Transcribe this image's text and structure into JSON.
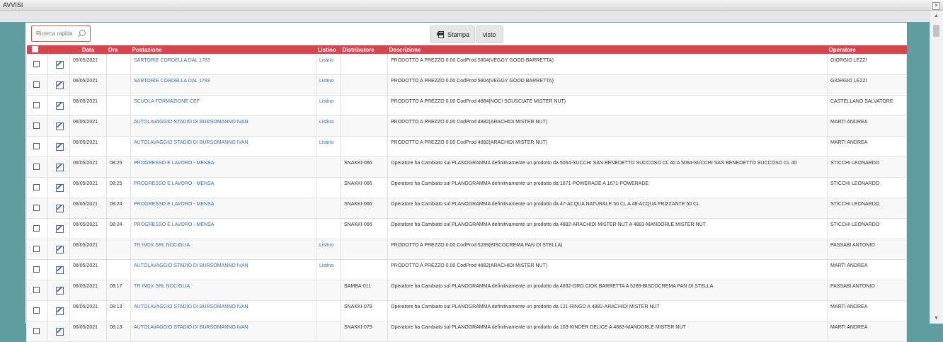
{
  "window": {
    "title": "AVVISI",
    "close_glyph": "×"
  },
  "toolbar": {
    "search_placeholder": "Ricerca rapida",
    "print_label": "Stampa",
    "seen_label": "visto"
  },
  "table": {
    "columns": [
      "Data",
      "Ora",
      "Postazione",
      "Listino",
      "Distributore",
      "Descrizione",
      "Operatore"
    ],
    "rows": [
      [
        "06/05/2021",
        "",
        "SARTORIE CORDELLA DAL 1783",
        "Listino",
        "",
        "PRODOTTO A PREZZO 0.00 CodProd 5804(VEGGY GOOD BARRETTA)",
        "GIORGIO LEZZI"
      ],
      [
        "06/05/2021",
        "",
        "SARTORIE CORDELLA DAL 1783",
        "Listino",
        "",
        "PRODOTTO A PREZZO 0.00 CodProd 5804(VEGGY GOOD BARRETTA)",
        "GIORGIO LEZZI"
      ],
      [
        "06/05/2021",
        "",
        "SCUOLA FORMAZIONE CEF",
        "Listino",
        "",
        "PRODOTTO A PREZZO 0.00 CodProd 4884(NOCI SGUSCIATE MISTER NUT)",
        "CASTELLANO SALVATORE"
      ],
      [
        "06/05/2021",
        "",
        "AUTOLAVAGGIO STADIO DI BURSOMANNO IVAN",
        "Listino",
        "",
        "PRODOTTO A PREZZO 0.00 CodProd 4882(ARACHIDI MISTER NUT)",
        "MARTI ANDREA"
      ],
      [
        "06/05/2021",
        "",
        "AUTOLAVAGGIO STADIO DI BURSOMANNO IVAN",
        "Listino",
        "",
        "PRODOTTO A PREZZO 0.00 CodProd 4882(ARACHIDI MISTER NUT)",
        "MARTI ANDREA"
      ],
      [
        "06/05/2021",
        "08:25",
        "PROGRESSO E LAVORO - MENSA",
        "",
        "SNAKKI-066",
        "Operatore ha Cambiato sul PLANOGRAMMA definitivamente un prodotto da 5064-SUCCHI SAN BENEDETTO SUCCOSO CL 40 A 5064-SUCCHI SAN BENEDETTO SUCCOSO CL 40",
        "STICCHI LEONARDO"
      ],
      [
        "06/05/2021",
        "08:25",
        "PROGRESSO E LAVORO - MENSA",
        "",
        "SNAKKI-066",
        "Operatore ha Cambiato sul PLANOGRAMMA definitivamente un prodotto da 1671-POWERADE A 1671-POWERADE",
        "STICCHI LEONARDO"
      ],
      [
        "06/05/2021",
        "08:24",
        "PROGRESSO E LAVORO - MENSA",
        "",
        "SNAKKI-066",
        "Operatore ha Cambiato sul PLANOGRAMMA definitivamente un prodotto da 47-ACQUA NATURALE 50 CL A 48-ACQUA FRIZZANTE 50 CL",
        "STICCHI LEONARDO"
      ],
      [
        "06/05/2021",
        "08:24",
        "PROGRESSO E LAVORO - MENSA",
        "",
        "SNAKKI-066",
        "Operatore ha Cambiato sul PLANOGRAMMA definitivamente un prodotto da 4882-ARACHIDI MISTER NUT A 4883-MANDORLE MISTER NUT",
        "STICCHI LEONARDO"
      ],
      [
        "06/05/2021",
        "",
        "TR INOX SRL NOCIGLIA",
        "Listino",
        "",
        "PRODOTTO A PREZZO 0.00 CodProd 5289(BISCOCREMA PAN DI STELLA)",
        "PASSABI ANTONIO"
      ],
      [
        "06/05/2021",
        "",
        "AUTOLAVAGGIO STADIO DI BURSOMANNO IVAN",
        "Listino",
        "",
        "PRODOTTO A PREZZO 0.00 CodProd 4882(ARACHIDI MISTER NUT)",
        "MARTI ANDREA"
      ],
      [
        "06/05/2021",
        "08:17",
        "TR INOX SRL NOCIGLIA",
        "",
        "SAMBA-011",
        "Operatore ha Cambiato sul PLANOGRAMMA definitivamente un prodotto da 4832-ORO CIOK BARRETTA A 5289-BISCOCREMA PAN DI STELLA",
        "PASSABI ANTONIO"
      ],
      [
        "06/05/2021",
        "08:13",
        "AUTOLAVAGGIO STADIO DI BURSOMANNO IVAN",
        "",
        "SNAKKI-079",
        "Operatore ha Cambiato sul PLANOGRAMMA definitivamente un prodotto da 121-RINGO A 4882-ARACHIDI MISTER NUT",
        "MARTI ANDREA"
      ],
      [
        "06/05/2021",
        "08:13",
        "AUTOLAVAGGIO STADIO DI BURSOMANNO IVAN",
        "",
        "SNAKKI-079",
        "Operatore ha Cambiato sul PLANOGRAMMA definitivamente un prodotto da 103-KINDER DELICE A 4883-MANDORLE MISTER NUT",
        "MARTI ANDREA"
      ]
    ]
  },
  "colors": {
    "header_red": "#d9454f",
    "teal_bg": "#5f9ea0",
    "link_blue": "#3b6fb0"
  },
  "icons": {
    "print": "printer-icon",
    "edit": "edit-icon",
    "search": "search-icon",
    "close": "close-icon"
  }
}
